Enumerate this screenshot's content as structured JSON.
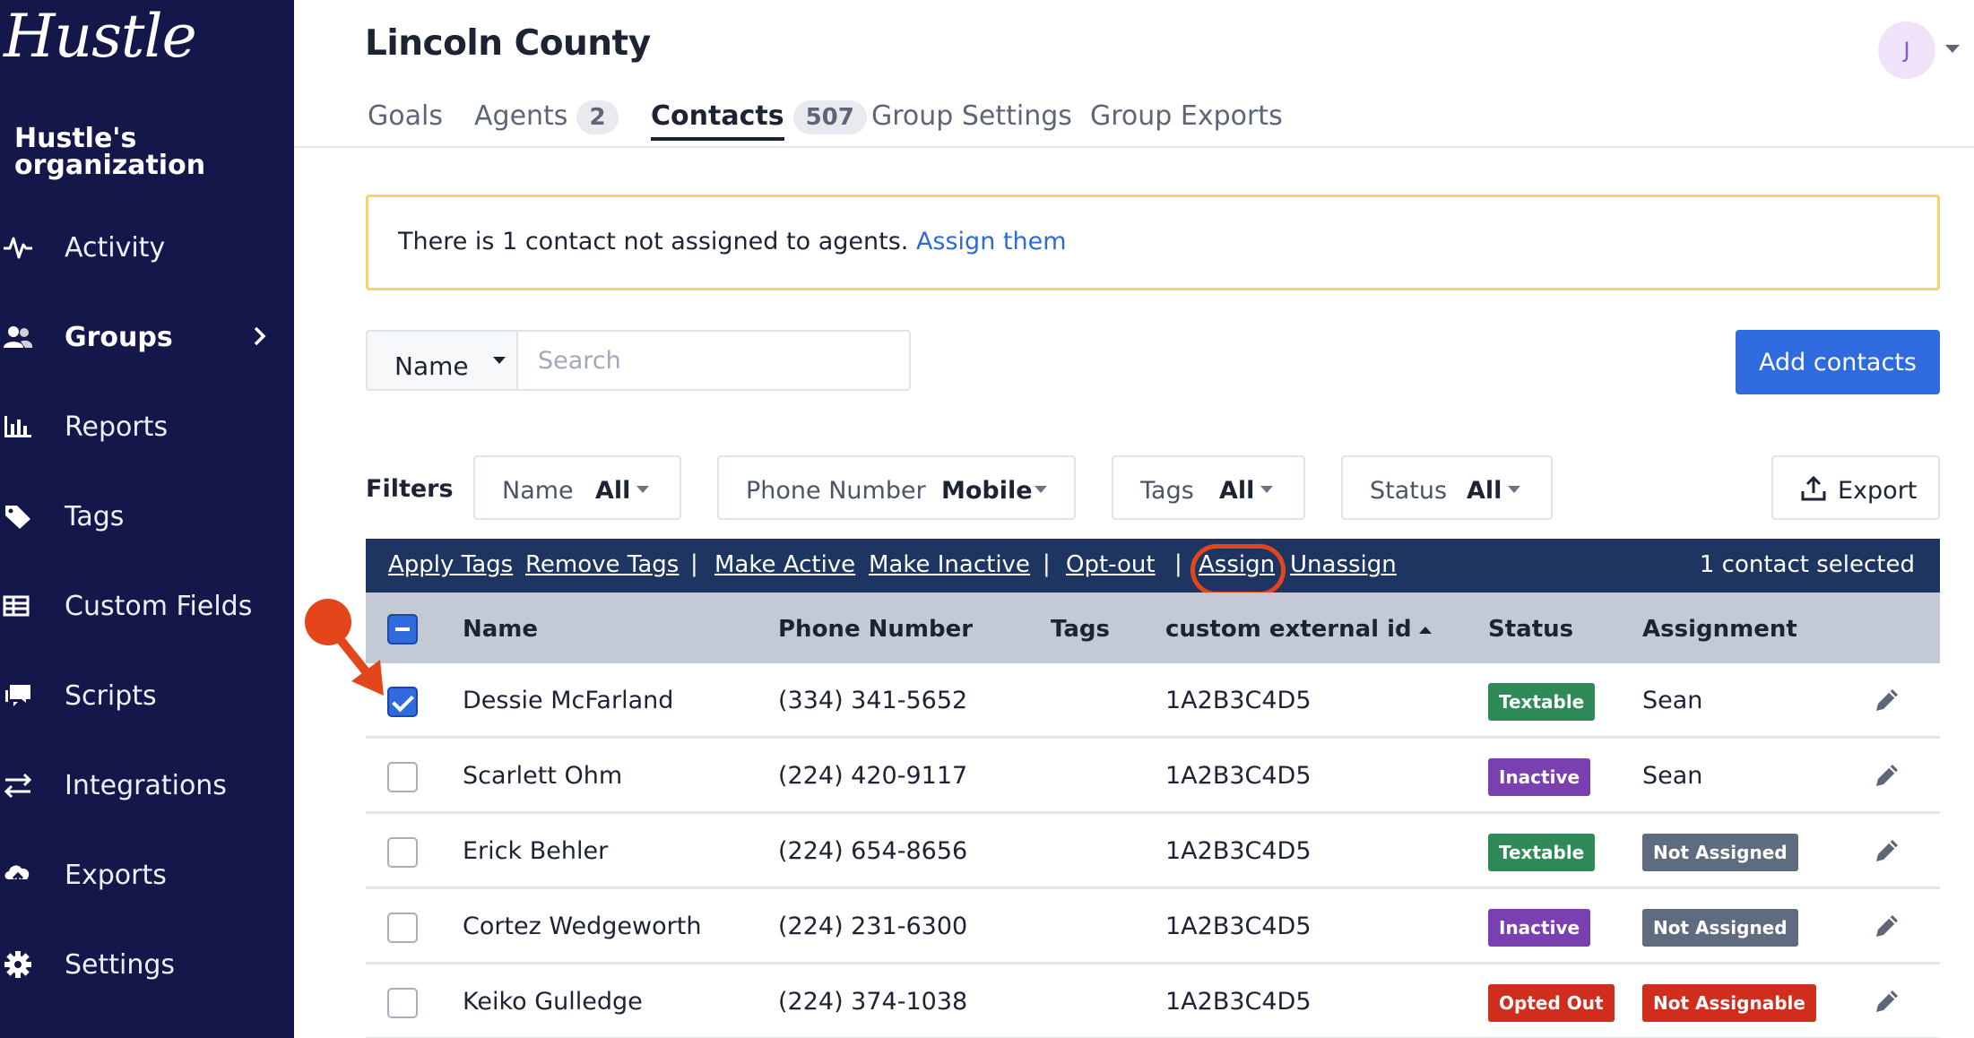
{
  "sidebar": {
    "logo": "Hustle",
    "org": "Hustle's organization",
    "items": [
      {
        "label": "Activity",
        "icon": "activity-icon"
      },
      {
        "label": "Groups",
        "icon": "groups-icon",
        "active": true
      },
      {
        "label": "Reports",
        "icon": "reports-icon"
      },
      {
        "label": "Tags",
        "icon": "tag-icon"
      },
      {
        "label": "Custom Fields",
        "icon": "custom-fields-icon"
      },
      {
        "label": "Scripts",
        "icon": "scripts-icon"
      },
      {
        "label": "Integrations",
        "icon": "integrations-icon"
      },
      {
        "label": "Exports",
        "icon": "exports-icon"
      },
      {
        "label": "Settings",
        "icon": "gear-icon"
      }
    ]
  },
  "header": {
    "title": "Lincoln County",
    "avatar": "J"
  },
  "tabs": [
    {
      "label": "Goals"
    },
    {
      "label": "Agents",
      "count": "2"
    },
    {
      "label": "Contacts",
      "count": "507",
      "active": true
    },
    {
      "label": "Group Settings"
    },
    {
      "label": "Group Exports"
    }
  ],
  "alert": {
    "text": "There is 1 contact not assigned to agents.",
    "link": "Assign them"
  },
  "search": {
    "field": "Name",
    "placeholder": "Search"
  },
  "add_button": "Add contacts",
  "filters": {
    "label": "Filters",
    "items": [
      {
        "name": "Name",
        "value": "All"
      },
      {
        "name": "Phone Number",
        "value": "Mobile"
      },
      {
        "name": "Tags",
        "value": "All"
      },
      {
        "name": "Status",
        "value": "All"
      }
    ],
    "export": "Export"
  },
  "bulk_actions": {
    "apply_tags": "Apply Tags",
    "remove_tags": "Remove Tags",
    "make_active": "Make Active",
    "make_inactive": "Make Inactive",
    "opt_out": "Opt-out",
    "assign": "Assign",
    "unassign": "Unassign",
    "separator": "|",
    "selected": "1 contact selected"
  },
  "table": {
    "columns": [
      "Name",
      "Phone Number",
      "Tags",
      "custom external id",
      "Status",
      "Assignment"
    ],
    "rows": [
      {
        "name": "Dessie McFarland",
        "phone": "(334) 341-5652",
        "tags": "",
        "external_id": "1A2B3C4D5",
        "status": "Textable",
        "assignment": "Sean",
        "checked": true
      },
      {
        "name": "Scarlett Ohm",
        "phone": "(224) 420-9117",
        "tags": "",
        "external_id": "1A2B3C4D5",
        "status": "Inactive",
        "assignment": "Sean",
        "checked": false
      },
      {
        "name": "Erick Behler",
        "phone": "(224) 654-8656",
        "tags": "",
        "external_id": "1A2B3C4D5",
        "status": "Textable",
        "assignment": "Not Assigned",
        "checked": false
      },
      {
        "name": "Cortez Wedgeworth",
        "phone": "(224) 231-6300",
        "tags": "",
        "external_id": "1A2B3C4D5",
        "status": "Inactive",
        "assignment": "Not Assigned",
        "checked": false
      },
      {
        "name": "Keiko Gulledge",
        "phone": "(224) 374-1038",
        "tags": "",
        "external_id": "1A2B3C4D5",
        "status": "Opted Out",
        "assignment": "Not Assignable",
        "checked": false
      }
    ]
  },
  "colors": {
    "sidebar_bg": "#14174a",
    "primary": "#2f6bde",
    "textable": "#2e8b57",
    "inactive": "#7a3fb0",
    "opted_out": "#d12d1d",
    "not_assigned": "#5f6b7f",
    "not_assignable": "#d12d1d",
    "annotation": "#e4461c",
    "alert_border": "#f4d36b"
  }
}
